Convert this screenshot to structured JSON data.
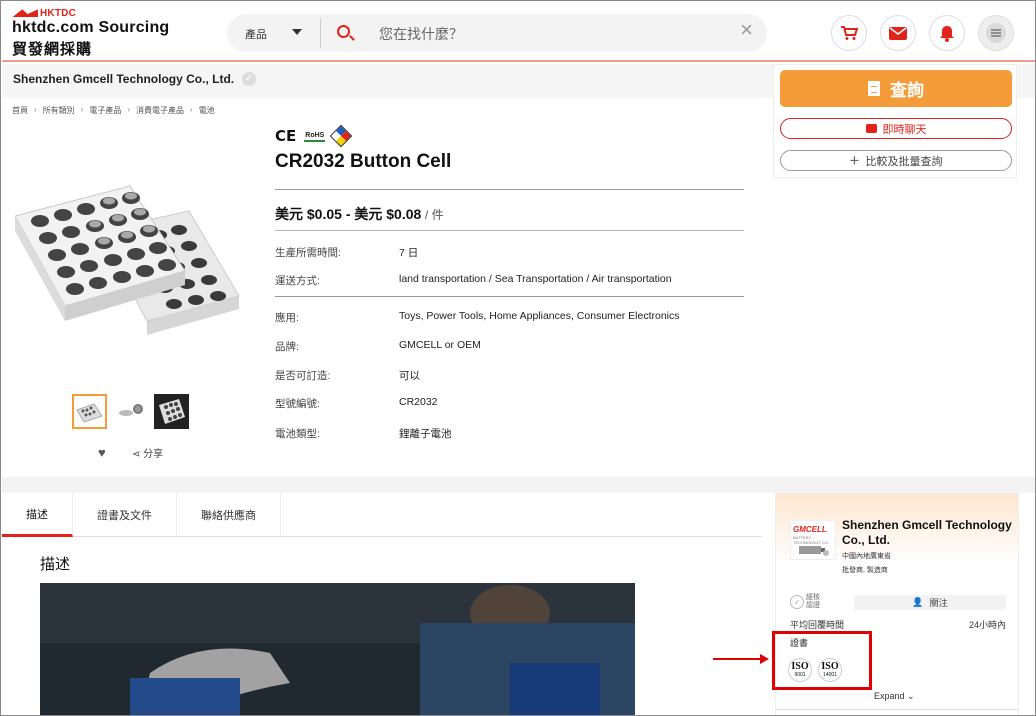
{
  "header": {
    "brand_small": "HKTDC",
    "brand_main": "hktdc.com Sourcing",
    "brand_sub": "貿發網採購",
    "search": {
      "category": "產品",
      "placeholder": "您在找什麼？"
    },
    "icons": [
      "cart-icon",
      "mail-icon",
      "bell-icon",
      "menu-icon"
    ]
  },
  "company_bar": {
    "name": "Shenzhen Gmcell Technology Co., Ltd."
  },
  "inquiry": {
    "inquire_label": "查詢",
    "chat_label": "即時聊天",
    "compare_label": "比較及批量查詢"
  },
  "breadcrumb": [
    "首頁",
    "所有類別",
    "電子產品",
    "消費電子產品",
    "電池"
  ],
  "gallery": {
    "share_label": "分享"
  },
  "product": {
    "cert_ce": "CE",
    "cert_rohs": "RoHS",
    "title": "CR2032 Button Cell",
    "price": {
      "range": "美元 $0.05 - 美元 $0.08",
      "unit": "/ 件"
    },
    "specs_group1": [
      {
        "label": "生產所需時間:",
        "value": "7 日"
      },
      {
        "label": "運送方式:",
        "value": "land transportation / Sea Transportation / Air transportation"
      }
    ],
    "specs_group2": [
      {
        "label": "應用:",
        "value": "Toys, Power Tools, Home Appliances, Consumer Electronics"
      },
      {
        "label": "品牌:",
        "value": "GMCELL or OEM"
      },
      {
        "label": "是否可訂造:",
        "value": "可以"
      },
      {
        "label": "型號編號:",
        "value": "CR2032"
      },
      {
        "label": "電池類型:",
        "value": "鋰離子電池"
      }
    ]
  },
  "tabs": [
    {
      "label": "描述",
      "active": true
    },
    {
      "label": "證書及文件",
      "active": false
    },
    {
      "label": "聯絡供應商",
      "active": false
    }
  ],
  "description": {
    "title": "描述"
  },
  "supplier": {
    "logo_text": "GMCELL",
    "logo_sub": "BATTERY TECHNOLOGY CO.",
    "name": "Shenzhen Gmcell Technology Co., Ltd.",
    "location": "中國內地廣東省",
    "business_type": "批發商, 製造商",
    "verified_label": "經核認證",
    "follow_label": "關注",
    "response_label": "平均回覆時間",
    "response_value": "24小時內",
    "certificates_label": "證書",
    "certs": [
      {
        "name": "ISO",
        "code": "9001"
      },
      {
        "name": "ISO",
        "code": "14001"
      }
    ],
    "expand_label": "Expand"
  },
  "colors": {
    "brand_red": "#e2231a",
    "inquire_orange": "#f49b3a",
    "annotation_red": "#e10000"
  }
}
